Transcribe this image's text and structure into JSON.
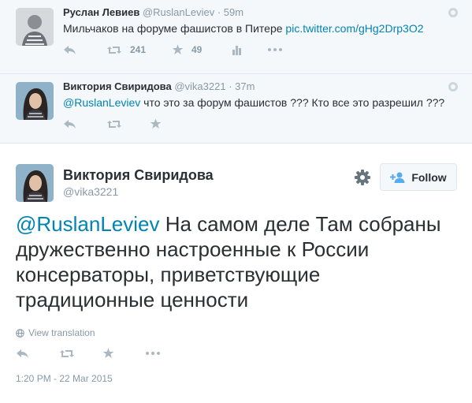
{
  "tweets": [
    {
      "name": "Руслан Левиев",
      "handle": "@RuslanLeviev",
      "dot": "·",
      "time": "59m",
      "text": "Мильчаков на форуме фашистов в Питере",
      "link": "pic.twitter.com/gHg2Drp3O2",
      "retweets": "241",
      "favorites": "49"
    },
    {
      "name": "Виктория Свиридова",
      "handle": "@vika3221",
      "dot": "·",
      "time": "37m",
      "mention": "@RuslanLeviev",
      "text": " что это за форум фашистов ??? Кто все это разрешил ???"
    }
  ],
  "main": {
    "name": "Виктория Свиридова",
    "handle": "@vika3221",
    "follow_label": "Follow",
    "mention": "@RuslanLeviev",
    "text": " На самом деле Там собраны дружественно настроенные к России консерваторы, приветствующие традиционные ценности",
    "translate_label": "View translation",
    "timestamp": "1:20 PM - 22 Mar 2015"
  },
  "icons": {
    "reply": "reply-icon",
    "retweet": "retweet-icon",
    "favorite": "star-icon",
    "stats": "stats-icon",
    "more": "more-icon",
    "gear": "gear-icon",
    "follow": "add-user-icon",
    "globe": "globe-icon"
  },
  "colors": {
    "link": "#0084b4",
    "muted": "#8899a6",
    "icon": "#aab8c2",
    "text": "#292f33",
    "context_bg": "#f5f8fa"
  }
}
